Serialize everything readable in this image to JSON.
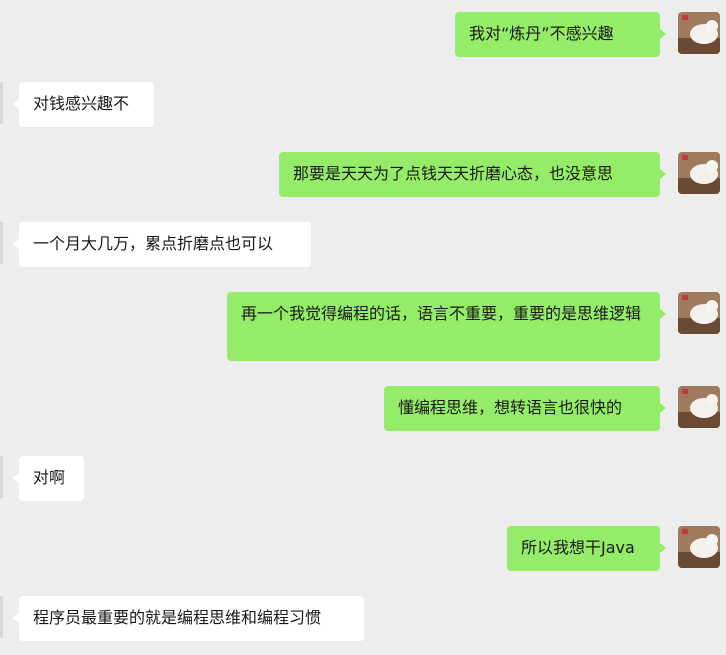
{
  "messages": [
    {
      "side": "self",
      "text": "我对“炼丹”不感兴趣"
    },
    {
      "side": "peer",
      "text": "对钱感兴趣不"
    },
    {
      "side": "self",
      "text": "那要是天天为了点钱天天折磨心态，也没意思"
    },
    {
      "side": "peer",
      "text": "一个月大几万，累点折磨点也可以"
    },
    {
      "side": "self",
      "text": "再一个我觉得编程的话，语言不重要，重要的是思维逻辑"
    },
    {
      "side": "self",
      "text": "懂编程思维，想转语言也很快的"
    },
    {
      "side": "peer",
      "text": "对啊"
    },
    {
      "side": "self",
      "text": "所以我想干Java"
    },
    {
      "side": "peer",
      "text": "程序员最重要的就是编程思维和编程习惯"
    }
  ],
  "colors": {
    "background": "#ededed",
    "self_bubble": "#95ec69",
    "peer_bubble": "#ffffff"
  }
}
